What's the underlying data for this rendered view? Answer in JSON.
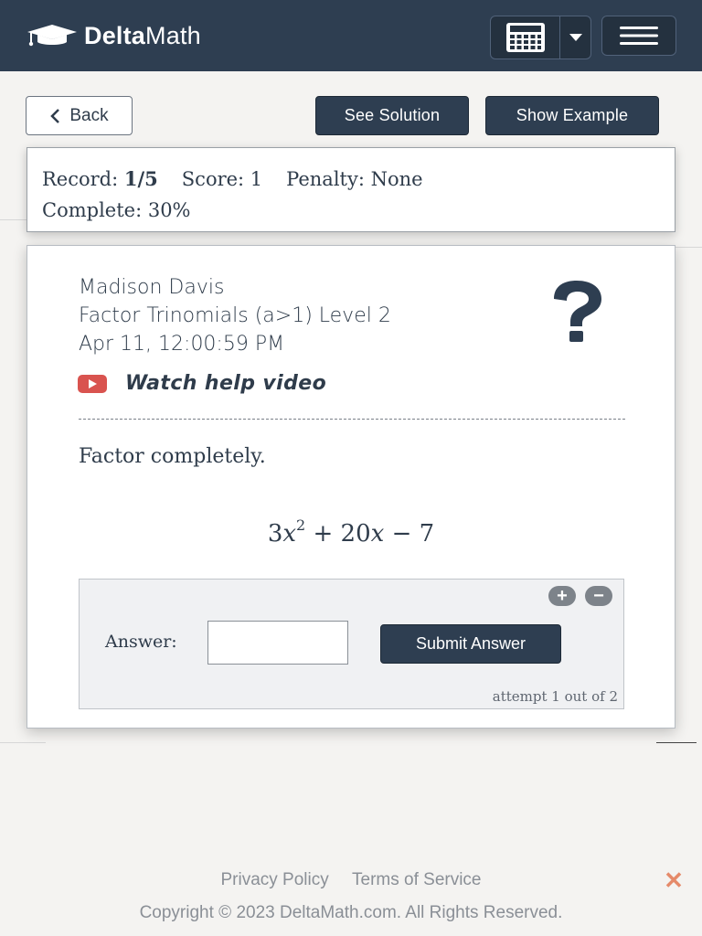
{
  "header": {
    "logo_text_bold": "Delta",
    "logo_text_regular": "Math",
    "calculator_icon": "calculator-icon",
    "caret_icon": "caret-down-icon",
    "menu_icon": "hamburger-menu-icon"
  },
  "actions": {
    "back_label": "Back",
    "see_solution_label": "See Solution",
    "show_example_label": "Show Example"
  },
  "record": {
    "record_label": "Record:",
    "record_value": "1/5",
    "score_text": "Score: 1",
    "penalty_text": "Penalty: None",
    "complete_text": "Complete: 30%"
  },
  "problem": {
    "student_name": "Madison Davis",
    "assignment": "Factor Trinomials (a>1) Level 2",
    "timestamp": "Apr 11, 12:00:59 PM",
    "help_video_label": "Watch help video",
    "instruction": "Factor completely.",
    "expression": {
      "coef1": "3",
      "var1": "x",
      "exp": "2",
      "middle": " + 20",
      "var2": "x",
      "tail": " − 7"
    }
  },
  "answer": {
    "label": "Answer:",
    "input_value": "",
    "submit_label": "Submit Answer",
    "attempt_text": "attempt 1 out of 2",
    "zoom_in": "+",
    "zoom_out": "−"
  },
  "footer": {
    "privacy": "Privacy Policy",
    "terms": "Terms of Service",
    "copyright": "Copyright © 2023 DeltaMath.com. All Rights Reserved.",
    "close_icon": "close-icon"
  },
  "colors": {
    "navbar": "#2e3e51",
    "primary_button": "#2e3e51",
    "youtube_red": "#d9534f",
    "close_x": "#e58a6a"
  }
}
